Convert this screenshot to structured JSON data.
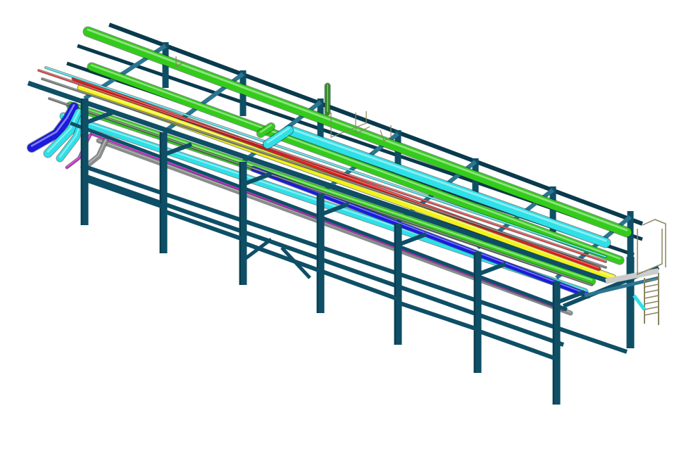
{
  "scene": {
    "subject": "pipe-rack",
    "background_color": "#ffffff",
    "colors": {
      "steel": "#0e4f66",
      "steel_dark": "#0a3a4c",
      "steel_light": "#2c7590",
      "pipe_green": "#33cc1a",
      "pipe_cyan": "#2ee0e8",
      "pipe_yellow": "#f2f21c",
      "pipe_red": "#e01c1c",
      "pipe_blue": "#1a1ae0",
      "pipe_purple": "#c21cc2",
      "pipe_gray": "#8c8c8c",
      "ladder": "#8a8560"
    },
    "bays_shown": 7,
    "pipe_runs": [
      {
        "name": "top-green-large",
        "color_key": "pipe_green"
      },
      {
        "name": "mid-green",
        "color_key": "pipe_green"
      },
      {
        "name": "cyan-large",
        "color_key": "pipe_cyan"
      },
      {
        "name": "yellow",
        "color_key": "pipe_yellow"
      },
      {
        "name": "red",
        "color_key": "pipe_red"
      },
      {
        "name": "green-lower",
        "color_key": "pipe_green"
      },
      {
        "name": "cyan-lower",
        "color_key": "pipe_cyan"
      },
      {
        "name": "blue",
        "color_key": "pipe_blue"
      },
      {
        "name": "gray",
        "color_key": "pipe_gray"
      },
      {
        "name": "purple",
        "color_key": "pipe_purple"
      }
    ]
  }
}
